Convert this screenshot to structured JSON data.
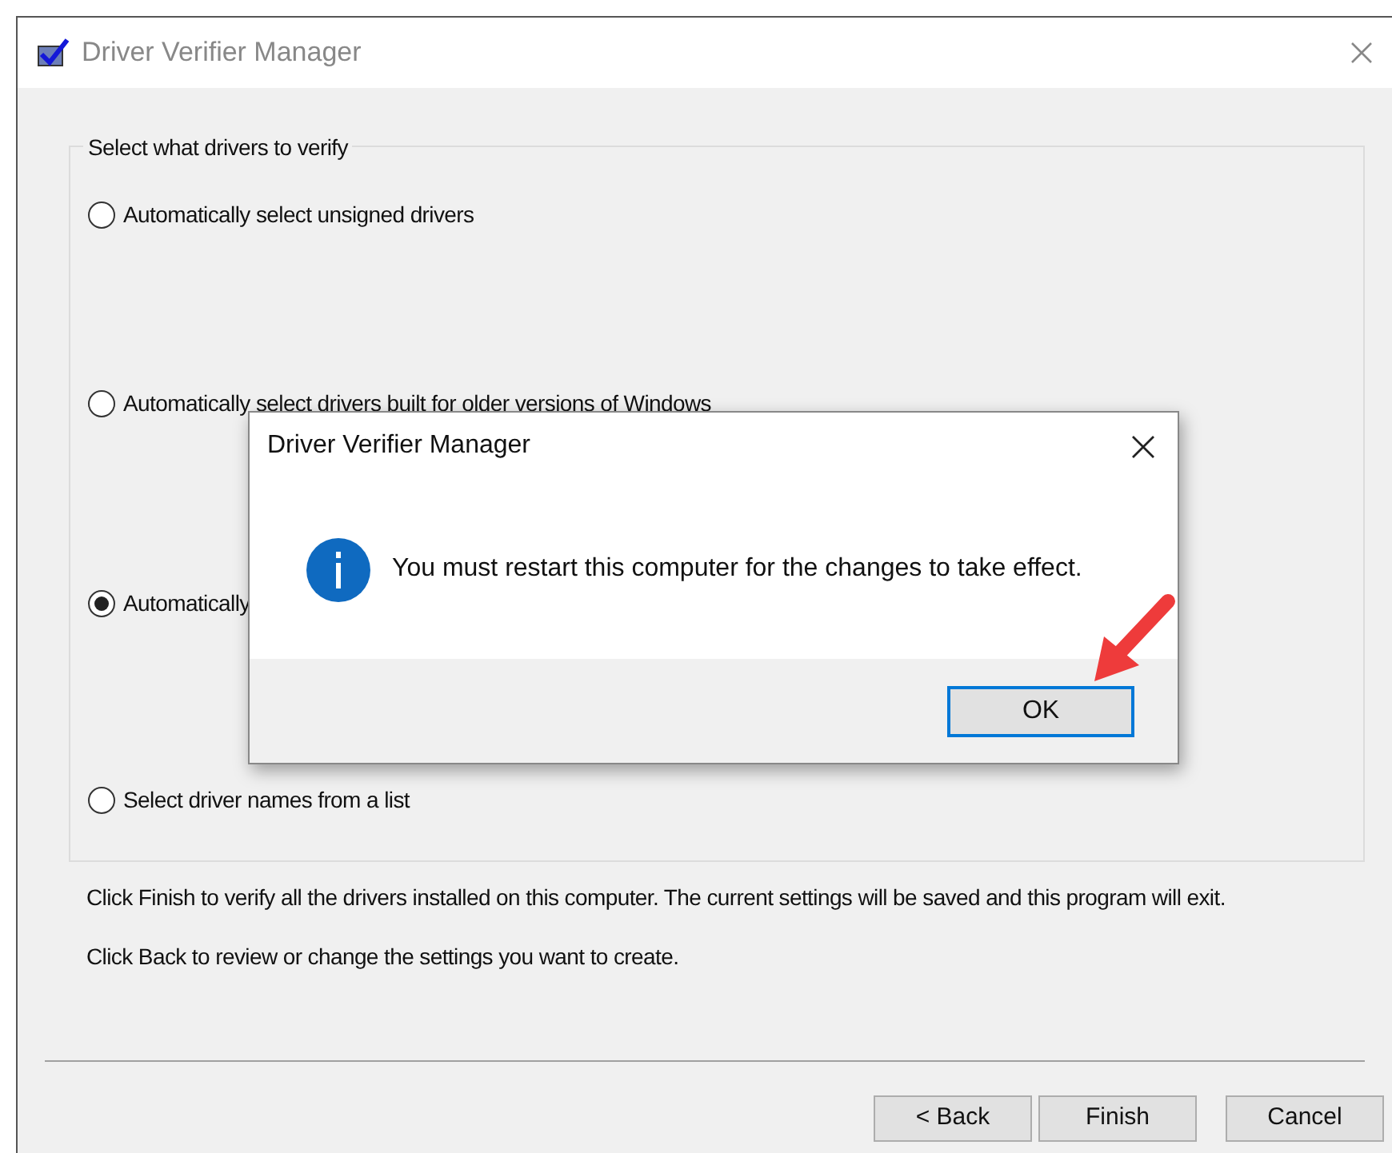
{
  "window": {
    "title": "Driver Verifier Manager"
  },
  "group": {
    "label": "Select what drivers to verify",
    "options": [
      {
        "label": "Automatically select unsigned drivers",
        "selected": false
      },
      {
        "label": "Automatically select drivers built for older versions of Windows",
        "selected": false
      },
      {
        "label": "Automatically",
        "selected": true
      },
      {
        "label": "Select driver names from a list",
        "selected": false
      }
    ]
  },
  "info_lines": [
    "Click Finish to verify all the drivers installed on this computer. The current settings will be saved and this program will exit.",
    "Click Back to review or change the settings you want to create."
  ],
  "buttons": [
    "< Back",
    "Finish",
    "Cancel"
  ],
  "dialog": {
    "title": "Driver Verifier Manager",
    "message": "You must restart this computer for the changes to take effect.",
    "button": "OK"
  }
}
